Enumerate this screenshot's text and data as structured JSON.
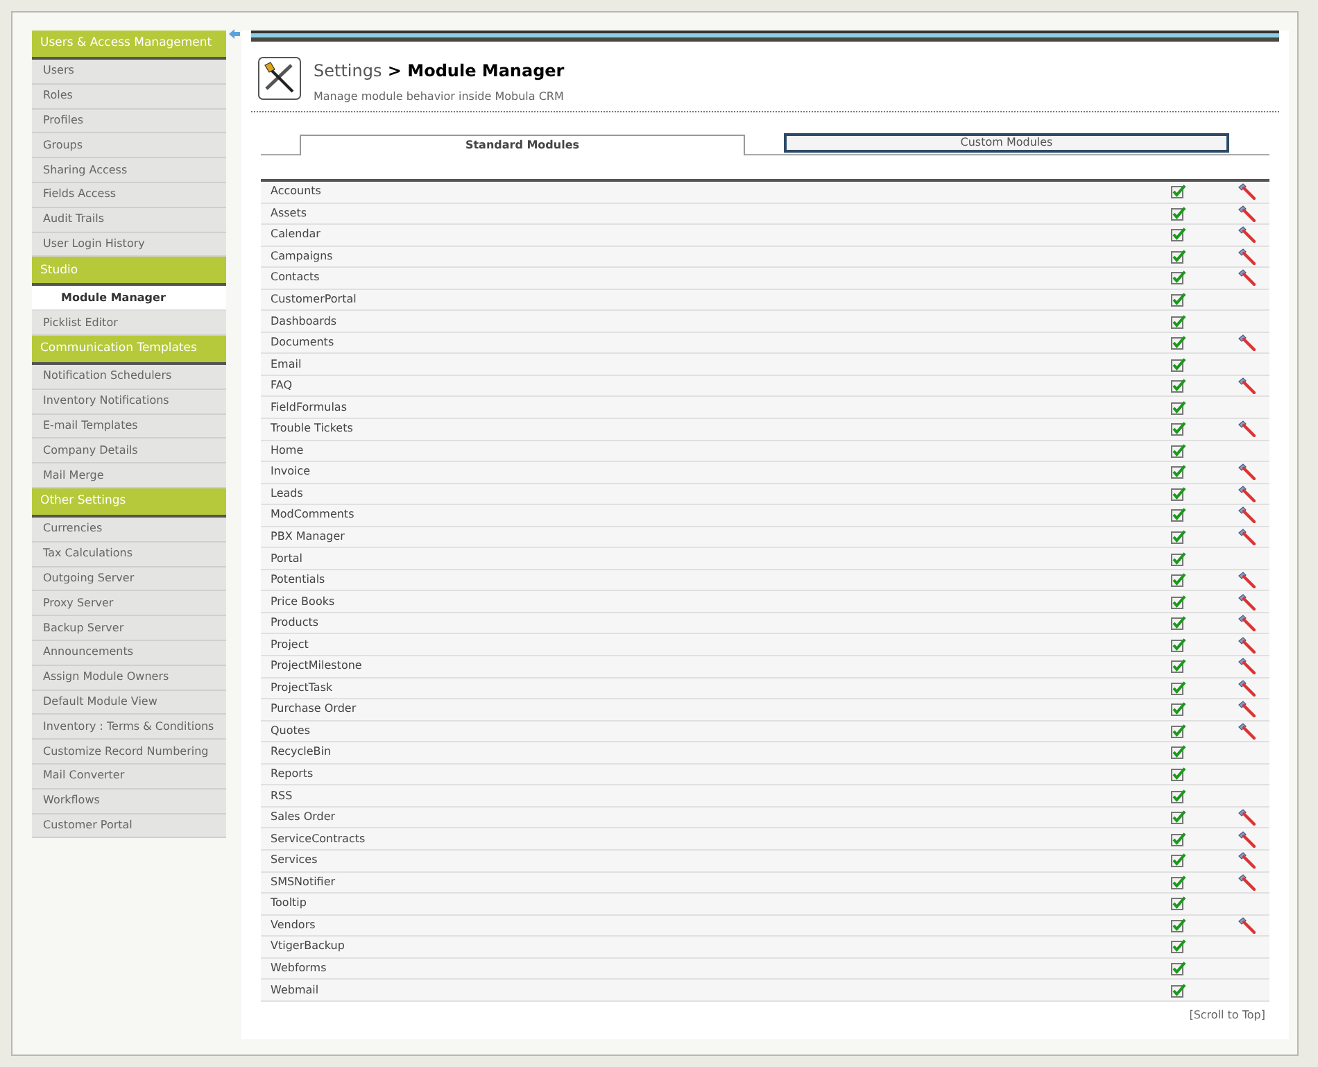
{
  "sidebar": {
    "sections": [
      {
        "title": "Users & Access Management",
        "items": [
          {
            "label": "Users",
            "selected": false
          },
          {
            "label": "Roles",
            "selected": false
          },
          {
            "label": "Profiles",
            "selected": false
          },
          {
            "label": "Groups",
            "selected": false
          },
          {
            "label": "Sharing Access",
            "selected": false
          },
          {
            "label": "Fields Access",
            "selected": false
          },
          {
            "label": "Audit Trails",
            "selected": false
          },
          {
            "label": "User Login History",
            "selected": false
          }
        ]
      },
      {
        "title": "Studio",
        "items": [
          {
            "label": "Module Manager",
            "selected": true
          },
          {
            "label": "Picklist Editor",
            "selected": false
          }
        ]
      },
      {
        "title": "Communication Templates",
        "items": [
          {
            "label": "Notification Schedulers",
            "selected": false
          },
          {
            "label": "Inventory Notifications",
            "selected": false
          },
          {
            "label": "E-mail Templates",
            "selected": false
          },
          {
            "label": "Company Details",
            "selected": false
          },
          {
            "label": "Mail Merge",
            "selected": false
          }
        ]
      },
      {
        "title": "Other Settings",
        "items": [
          {
            "label": "Currencies",
            "selected": false
          },
          {
            "label": "Tax Calculations",
            "selected": false
          },
          {
            "label": "Outgoing Server",
            "selected": false
          },
          {
            "label": "Proxy Server",
            "selected": false
          },
          {
            "label": "Backup Server",
            "selected": false
          },
          {
            "label": "Announcements",
            "selected": false
          },
          {
            "label": "Assign Module Owners",
            "selected": false
          },
          {
            "label": "Default Module View",
            "selected": false
          },
          {
            "label": "Inventory : Terms & Conditions",
            "selected": false
          },
          {
            "label": "Customize Record Numbering",
            "selected": false
          },
          {
            "label": "Mail Converter",
            "selected": false
          },
          {
            "label": "Workflows",
            "selected": false
          },
          {
            "label": "Customer Portal",
            "selected": false
          }
        ]
      }
    ]
  },
  "header": {
    "breadcrumb": "Settings",
    "title": "> Module Manager",
    "subtitle": "Manage module behavior inside Mobula CRM"
  },
  "tabs": [
    {
      "label": "Standard Modules",
      "selected": true
    },
    {
      "label": "Custom Modules",
      "selected": false
    }
  ],
  "modules": [
    {
      "name": "Accounts",
      "enabled": true,
      "configurable": true
    },
    {
      "name": "Assets",
      "enabled": true,
      "configurable": true
    },
    {
      "name": "Calendar",
      "enabled": true,
      "configurable": true
    },
    {
      "name": "Campaigns",
      "enabled": true,
      "configurable": true
    },
    {
      "name": "Contacts",
      "enabled": true,
      "configurable": true
    },
    {
      "name": "CustomerPortal",
      "enabled": true,
      "configurable": false
    },
    {
      "name": "Dashboards",
      "enabled": true,
      "configurable": false
    },
    {
      "name": "Documents",
      "enabled": true,
      "configurable": true
    },
    {
      "name": "Email",
      "enabled": true,
      "configurable": false
    },
    {
      "name": "FAQ",
      "enabled": true,
      "configurable": true
    },
    {
      "name": "FieldFormulas",
      "enabled": true,
      "configurable": false
    },
    {
      "name": "Trouble Tickets",
      "enabled": true,
      "configurable": true
    },
    {
      "name": "Home",
      "enabled": true,
      "configurable": false
    },
    {
      "name": "Invoice",
      "enabled": true,
      "configurable": true
    },
    {
      "name": "Leads",
      "enabled": true,
      "configurable": true
    },
    {
      "name": "ModComments",
      "enabled": true,
      "configurable": true
    },
    {
      "name": "PBX Manager",
      "enabled": true,
      "configurable": true
    },
    {
      "name": "Portal",
      "enabled": true,
      "configurable": false
    },
    {
      "name": "Potentials",
      "enabled": true,
      "configurable": true
    },
    {
      "name": "Price Books",
      "enabled": true,
      "configurable": true
    },
    {
      "name": "Products",
      "enabled": true,
      "configurable": true
    },
    {
      "name": "Project",
      "enabled": true,
      "configurable": true
    },
    {
      "name": "ProjectMilestone",
      "enabled": true,
      "configurable": true
    },
    {
      "name": "ProjectTask",
      "enabled": true,
      "configurable": true
    },
    {
      "name": "Purchase Order",
      "enabled": true,
      "configurable": true
    },
    {
      "name": "Quotes",
      "enabled": true,
      "configurable": true
    },
    {
      "name": "RecycleBin",
      "enabled": true,
      "configurable": false
    },
    {
      "name": "Reports",
      "enabled": true,
      "configurable": false
    },
    {
      "name": "RSS",
      "enabled": true,
      "configurable": false
    },
    {
      "name": "Sales Order",
      "enabled": true,
      "configurable": true
    },
    {
      "name": "ServiceContracts",
      "enabled": true,
      "configurable": true
    },
    {
      "name": "Services",
      "enabled": true,
      "configurable": true
    },
    {
      "name": "SMSNotifier",
      "enabled": true,
      "configurable": true
    },
    {
      "name": "Tooltip",
      "enabled": true,
      "configurable": false
    },
    {
      "name": "Vendors",
      "enabled": true,
      "configurable": true
    },
    {
      "name": "VtigerBackup",
      "enabled": true,
      "configurable": false
    },
    {
      "name": "Webforms",
      "enabled": true,
      "configurable": false
    },
    {
      "name": "Webmail",
      "enabled": true,
      "configurable": false
    }
  ],
  "footer_link": "[Scroll to Top]"
}
